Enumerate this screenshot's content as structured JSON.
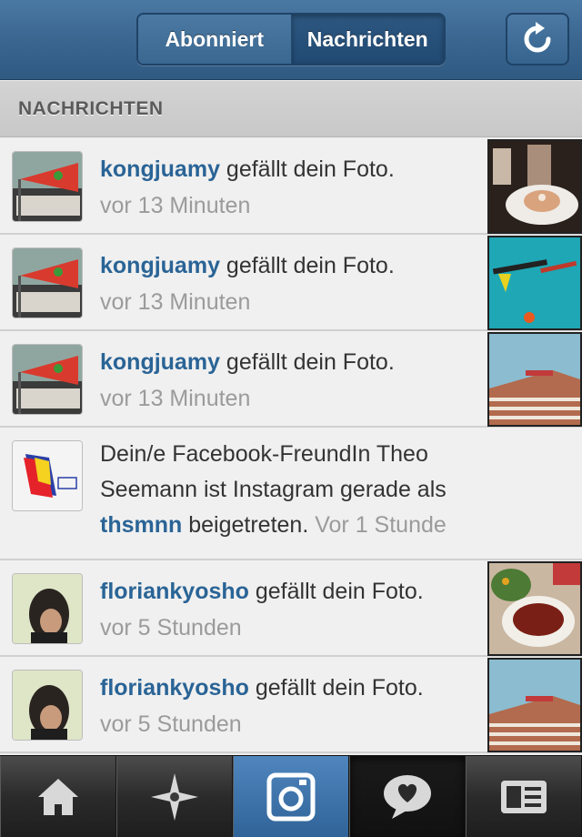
{
  "header": {
    "segments": [
      {
        "label": "Abonniert",
        "selected": false
      },
      {
        "label": "Nachrichten",
        "selected": true
      }
    ],
    "refresh_icon": "refresh-icon"
  },
  "section": {
    "title": "NACHRICHTEN"
  },
  "notifications": [
    {
      "user": "kongjuamy",
      "action": " gefällt dein Foto.",
      "time": "vor 13 Minuten"
    },
    {
      "user": "kongjuamy",
      "action": " gefällt dein Foto.",
      "time": "vor 13 Minuten"
    },
    {
      "user": "kongjuamy",
      "action": " gefällt dein Foto.",
      "time": "vor 13 Minuten"
    },
    {
      "pre": "Dein/e Facebook-FreundIn Theo Seemann ist Instagram gerade als ",
      "user": "thsmnn",
      "action": " beigetreten. ",
      "time": "Vor 1 Stunde"
    },
    {
      "user": "floriankyosho",
      "action": " gefällt dein Foto.",
      "time": "vor 5 Stunden"
    },
    {
      "user": "floriankyosho",
      "action": " gefällt dein Foto.",
      "time": "vor 5 Stunden"
    }
  ],
  "tabs": [
    {
      "icon": "home-icon"
    },
    {
      "icon": "explore-star-icon"
    },
    {
      "icon": "camera-icon"
    },
    {
      "icon": "news-speech-heart-icon"
    },
    {
      "icon": "profile-card-icon"
    }
  ],
  "colors": {
    "navbar": "#3a6690",
    "username": "#2a6496",
    "timestamp": "#9b9b9b",
    "active_tab": "#2f6398"
  }
}
